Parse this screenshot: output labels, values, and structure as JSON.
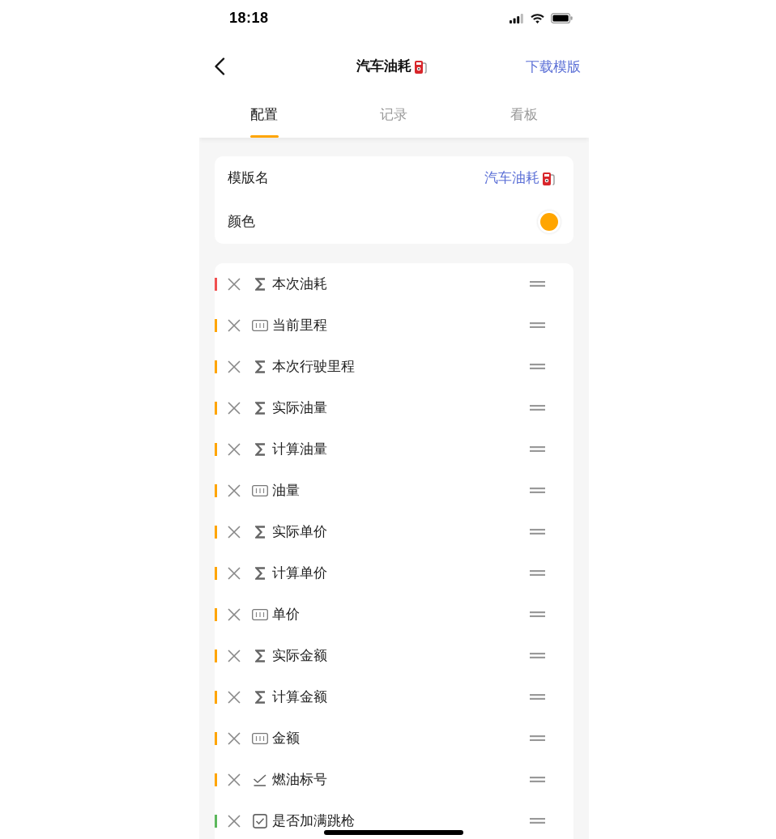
{
  "status_bar": {
    "time": "18:18"
  },
  "nav": {
    "title": "汽车油耗",
    "action": "下载模版"
  },
  "tabs": [
    {
      "label": "配置",
      "selected": true
    },
    {
      "label": "记录",
      "selected": false
    },
    {
      "label": "看板",
      "selected": false
    }
  ],
  "template": {
    "name_label": "模版名",
    "name_value": "汽车油耗",
    "color_label": "颜色",
    "color": "#ffa500"
  },
  "fields": [
    {
      "name": "本次油耗",
      "kind": "formula",
      "color": "#f05050"
    },
    {
      "name": "当前里程",
      "kind": "number",
      "color": "#ffa500"
    },
    {
      "name": "本次行驶里程",
      "kind": "formula",
      "color": "#ffa500"
    },
    {
      "name": "实际油量",
      "kind": "formula",
      "color": "#ffa500"
    },
    {
      "name": "计算油量",
      "kind": "formula",
      "color": "#ffa500"
    },
    {
      "name": "油量",
      "kind": "number",
      "color": "#ffa500"
    },
    {
      "name": "实际单价",
      "kind": "formula",
      "color": "#ffa500"
    },
    {
      "name": "计算单价",
      "kind": "formula",
      "color": "#ffa500"
    },
    {
      "name": "单价",
      "kind": "number",
      "color": "#ffa500"
    },
    {
      "name": "实际金额",
      "kind": "formula",
      "color": "#ffa500"
    },
    {
      "name": "计算金额",
      "kind": "formula",
      "color": "#ffa500"
    },
    {
      "name": "金额",
      "kind": "number",
      "color": "#ffa500"
    },
    {
      "name": "燃油标号",
      "kind": "select",
      "color": "#ffa500"
    },
    {
      "name": "是否加满跳枪",
      "kind": "checkbox",
      "color": "#5cb85c"
    }
  ]
}
